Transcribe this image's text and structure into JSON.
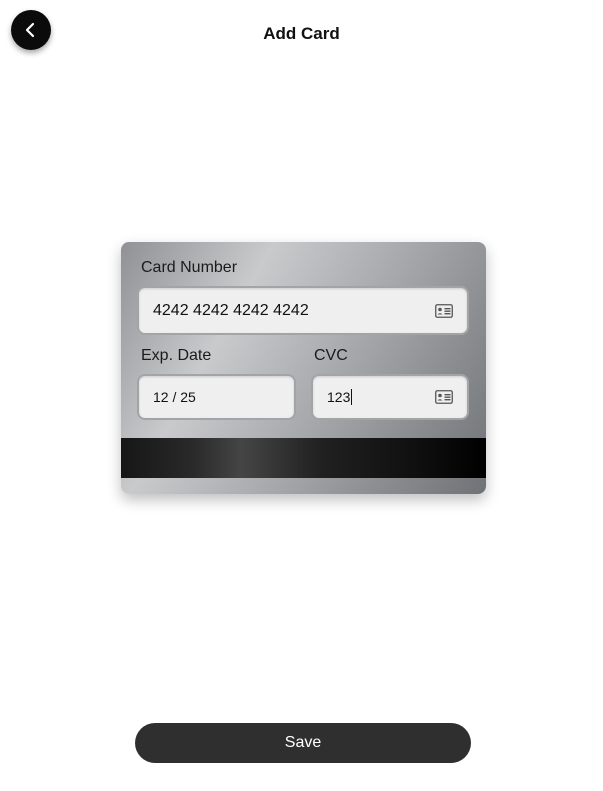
{
  "header": {
    "title": "Add Card",
    "back_icon": "chevron-left-icon"
  },
  "card": {
    "card_number_label": "Card Number",
    "card_number_value": "4242 4242 4242 4242",
    "exp_label": "Exp. Date",
    "exp_value": "12 / 25",
    "cvc_label": "CVC",
    "cvc_value": "123",
    "field_icon": "id-card-icon"
  },
  "footer": {
    "save_label": "Save"
  },
  "colors": {
    "primary_button": "#2f2f2f",
    "back_button": "#0b0b0b"
  }
}
